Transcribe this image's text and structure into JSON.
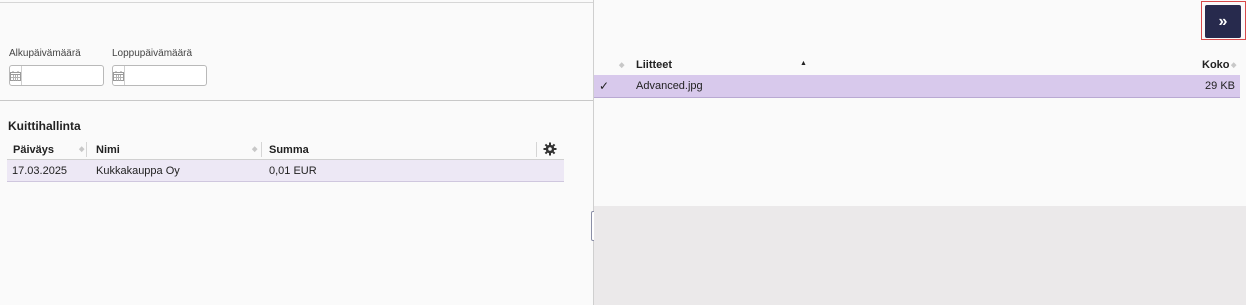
{
  "filters": {
    "start_date_label": "Alkupäivämäärä",
    "end_date_label": "Loppupäivämäärä",
    "start_date_value": "",
    "end_date_value": ""
  },
  "receipts": {
    "title": "Kuittihallinta",
    "columns": [
      "Päiväys",
      "Nimi",
      "Summa"
    ],
    "rows": [
      {
        "date": "17.03.2025",
        "name": "Kukkakauppa Oy",
        "amount": "0,01 EUR"
      }
    ]
  },
  "attachments": {
    "expand_label": "»",
    "columns": {
      "name": "Liitteet",
      "size": "Koko"
    },
    "rows": [
      {
        "checked": "✓",
        "name": "Advanced.jpg",
        "size": "29 KB"
      }
    ]
  },
  "colors": {
    "selected_row": "#d8c9ec",
    "row_highlight": "#ede8f5",
    "expand_button": "#272a4d",
    "focus_outline": "#d84a4a"
  }
}
